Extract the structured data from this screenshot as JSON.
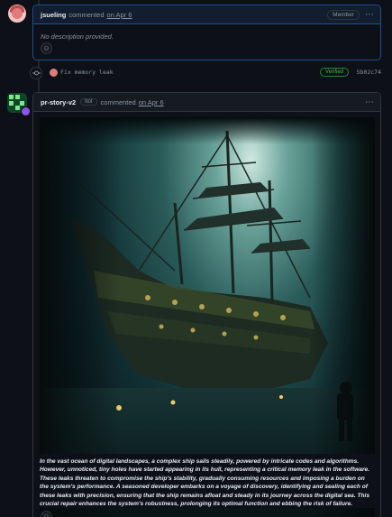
{
  "comments": [
    {
      "author": "jsueling",
      "action": "commented",
      "date_link": "on Apr 6",
      "role_badge": "Member",
      "body": "No description provided."
    },
    {
      "author": "pr-story-v2",
      "bot_label": "bot",
      "action": "commented",
      "date_link": "on Apr 6",
      "caption": "In the vast ocean of digital landscapes, a complex ship sails steadily, powered by intricate codes and algorithms. However, unnoticed, tiny holes have started appearing in its hull, representing a critical memory leak in the software. These leaks threaten to compromise the ship's stability, gradually consuming resources and imposing a burden on the system's performance. A seasoned developer embarks on a voyage of discovery, identifying and sealing each of these leaks with precision, ensuring that the ship remains afloat and steady in its journey across the digital sea. This crucial repair enhances the system's robustness, prolonging its optimal function and ebbing the risk of failure."
    }
  ],
  "commit": {
    "message": "Fix memory leak",
    "verified_label": "Verified",
    "sha": "5b02c74"
  },
  "icons": {
    "kebab": "⋯",
    "emoji": "☺",
    "commit": "-o-"
  },
  "colors": {
    "background": "#0d1117",
    "border": "#30363d",
    "verified": "#3fb950",
    "bot_avatar": "#7ee787"
  }
}
